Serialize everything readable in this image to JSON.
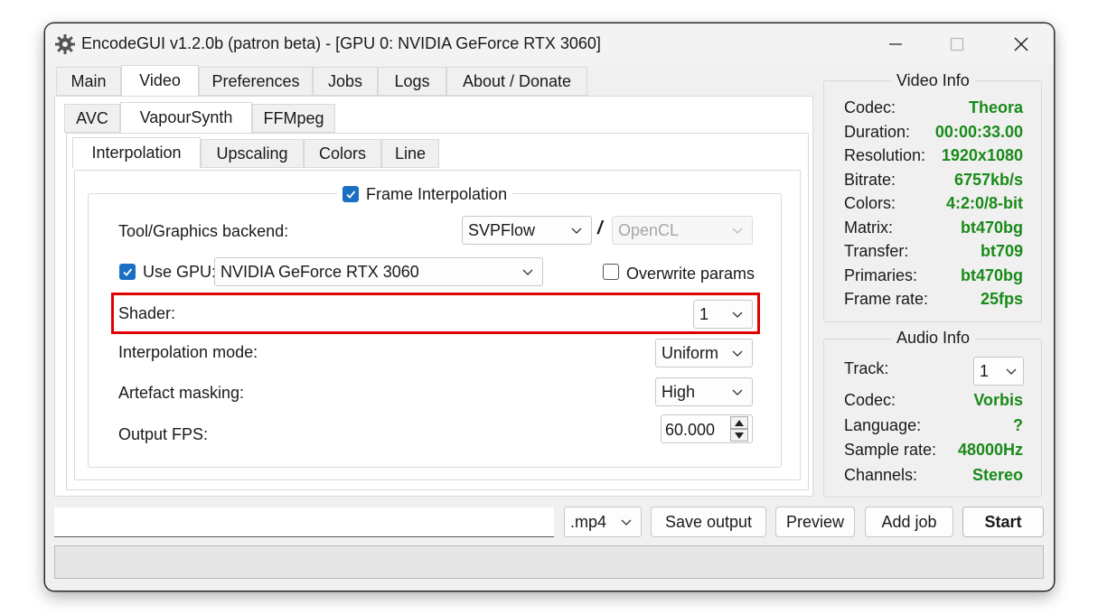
{
  "window": {
    "title": "EncodeGUI v1.2.0b (patron beta) - [GPU 0: NVIDIA GeForce RTX 3060]"
  },
  "main_tabs": [
    "Main",
    "Video",
    "Preferences",
    "Jobs",
    "Logs",
    "About / Donate"
  ],
  "video_tabs": [
    "AVC",
    "VapourSynth",
    "FFMpeg"
  ],
  "vs_tabs": [
    "Interpolation",
    "Upscaling",
    "Colors",
    "Line"
  ],
  "interp": {
    "group_label": "Frame Interpolation",
    "backend_label": "Tool/Graphics backend:",
    "backend_value": "SVPFlow",
    "backend_sep": "/",
    "backend_api": "OpenCL",
    "use_gpu_label": "Use GPU:",
    "gpu_value": "NVIDIA GeForce RTX 3060",
    "overwrite_label": "Overwrite params",
    "shader_label": "Shader:",
    "shader_value": "1",
    "mode_label": "Interpolation mode:",
    "mode_value": "Uniform",
    "mask_label": "Artefact masking:",
    "mask_value": "High",
    "fps_label": "Output FPS:",
    "fps_value": "60.000"
  },
  "video_info": {
    "title": "Video Info",
    "rows": [
      {
        "k": "Codec:",
        "v": "Theora"
      },
      {
        "k": "Duration:",
        "v": "00:00:33.00"
      },
      {
        "k": "Resolution:",
        "v": "1920x1080"
      },
      {
        "k": "Bitrate:",
        "v": "6757kb/s"
      },
      {
        "k": "Colors:",
        "v": "4:2:0/8-bit"
      },
      {
        "k": "Matrix:",
        "v": "bt470bg"
      },
      {
        "k": "Transfer:",
        "v": "bt709"
      },
      {
        "k": "Primaries:",
        "v": "bt470bg"
      },
      {
        "k": "Frame rate:",
        "v": "25fps"
      }
    ]
  },
  "audio_info": {
    "title": "Audio Info",
    "track_label": "Track:",
    "track_value": "1",
    "rows": [
      {
        "k": "Codec:",
        "v": "Vorbis"
      },
      {
        "k": "Language:",
        "v": "?"
      },
      {
        "k": "Sample rate:",
        "v": "48000Hz"
      },
      {
        "k": "Channels:",
        "v": "Stereo"
      }
    ]
  },
  "bottom": {
    "output_path": "",
    "container": ".mp4",
    "save_output": "Save output",
    "preview": "Preview",
    "add_job": "Add job",
    "start": "Start"
  },
  "colors": {
    "value_green": "#1a8a1a",
    "highlight": "#e00000",
    "checkbox_blue": "#1a6fc2"
  }
}
